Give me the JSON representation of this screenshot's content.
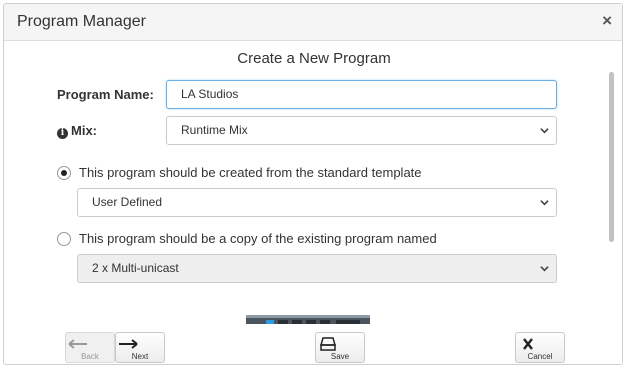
{
  "dialog": {
    "title": "Program Manager",
    "close_label": "×",
    "heading": "Create a New Program"
  },
  "form": {
    "program_name_label": "Program Name:",
    "program_name_value": "LA Studios",
    "mix_label": "Mix:",
    "mix_selected": "Runtime Mix",
    "option_template_label": "This program should be created from the standard template",
    "option_template_checked": true,
    "template_selected": "User Defined",
    "option_copy_label": "This program should be a copy of the existing program named",
    "option_copy_checked": false,
    "copy_selected": "2 x Multi-unicast"
  },
  "footer": {
    "back_label": "Back",
    "next_label": "Next",
    "save_label": "Save",
    "cancel_label": "Cancel"
  },
  "icons": {
    "info": "info-circle-icon",
    "back": "arrow-left-icon",
    "next": "arrow-right-icon",
    "save": "drive-icon",
    "cancel": "x-icon",
    "dropdown": "chevron-down-icon"
  },
  "colors": {
    "focus_border": "#66afe9",
    "titlebar_bg": "#f5f5f5"
  }
}
